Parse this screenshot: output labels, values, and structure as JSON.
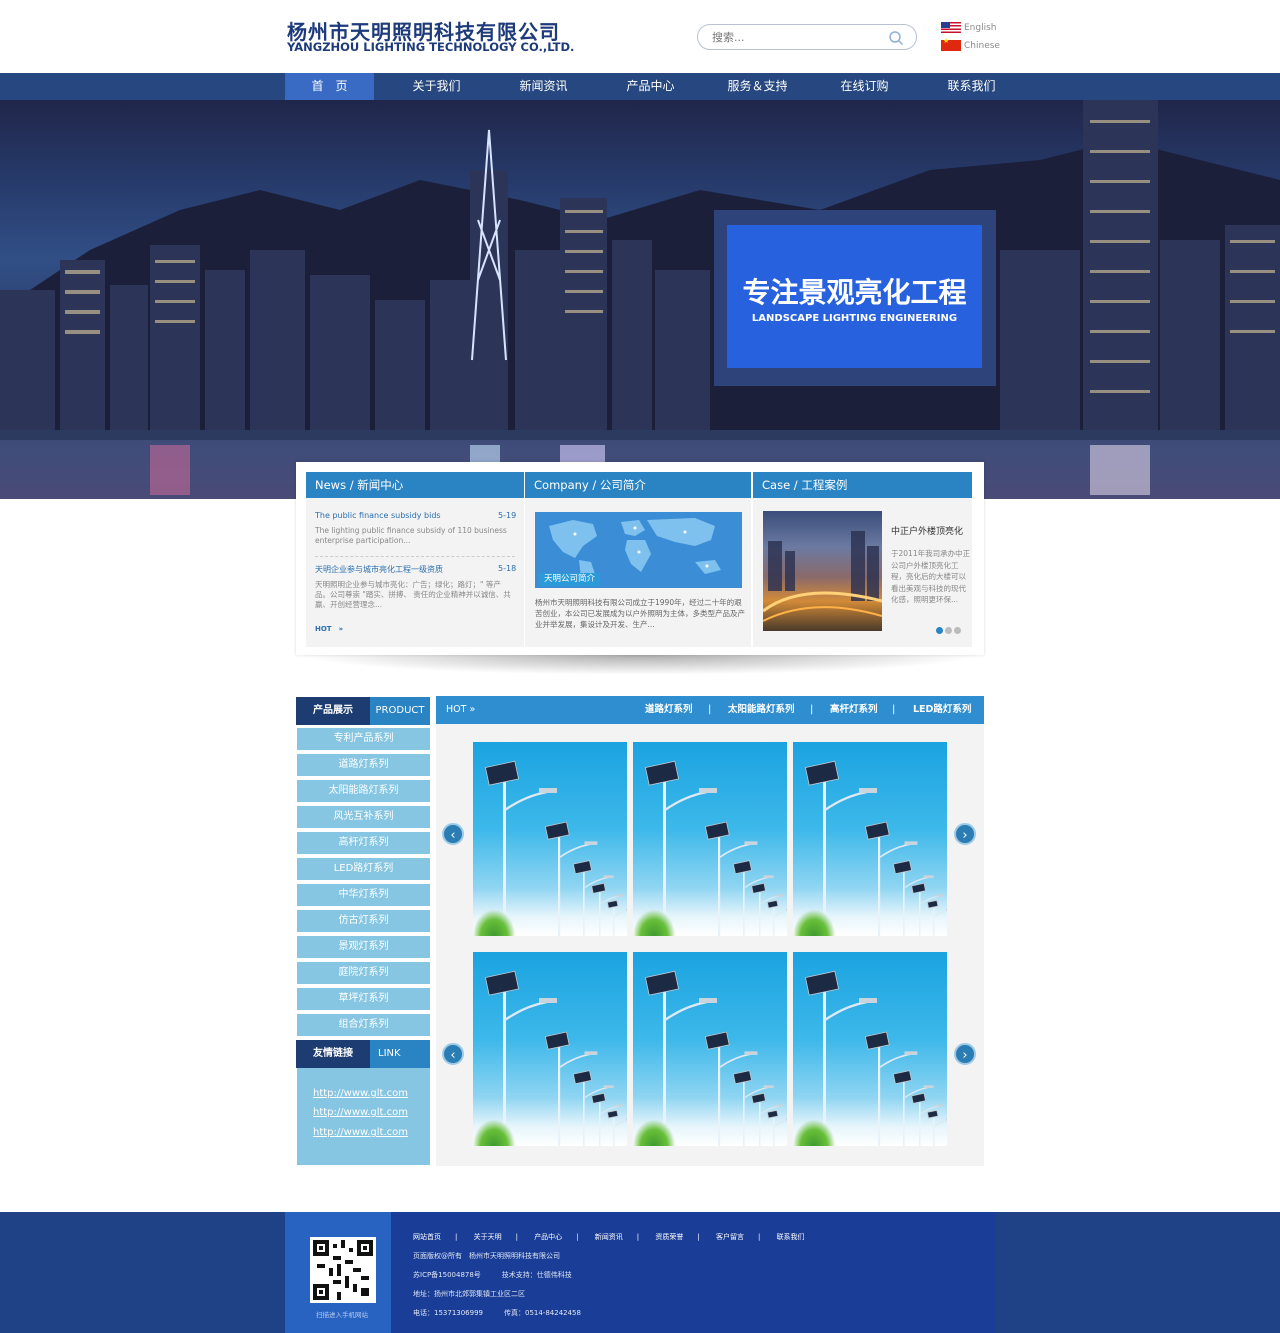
{
  "header": {
    "company_cn": "杨州市天明照明科技有限公司",
    "company_en": "YANGZHOU LIGHTING TECHNOLOGY CO.,LTD.",
    "search_placeholder": "搜索...",
    "lang_en": "English",
    "lang_cn": "Chinese"
  },
  "nav": {
    "items": [
      "首　页",
      "关于我们",
      "新闻资讯",
      "产品中心",
      "服务＆支持",
      "在线订购",
      "联系我们"
    ]
  },
  "banner": {
    "title": "专注景观亮化工程",
    "subtitle": "LANDSCAPE LIGHTING ENGINEERING"
  },
  "info": {
    "news": {
      "header": "News / 新闻中心",
      "items": [
        {
          "title": "The public finance subsidy bids",
          "date": "5-19",
          "desc": "The lighting public finance subsidy of 110 business enterprise participation..."
        },
        {
          "title": "天明企业参与城市亮化工程一级资质",
          "date": "5-18",
          "desc": "天明照明企业参与城市亮化：广告；绿化；路灯；\" 等产品。公司尊崇 \"踏实、拼搏、 责任的企业精神并以诚信、共赢、开创经营理念..."
        }
      ],
      "hot": "HOT"
    },
    "company": {
      "header": "Company / 公司简介",
      "image_label": "天明公司简介",
      "text": "杨州市天明照明科技有限公司成立于1990年，经过二十年的艰苦创业，本公司已发展成为以户外照明为主体，多类型产品及产业并举发展，集设计及开发、生产..."
    },
    "case": {
      "header": "Case / 工程案例",
      "title": "中正户外楼顶亮化",
      "desc": "于2011年我司承办中正公司户外楼顶亮化工程，亮化后的大楼可以看出美观与科技的现代化感，照明更环保..."
    }
  },
  "products": {
    "side_head_cn": "产品展示",
    "side_head_en": "PRODUCT",
    "categories": [
      "专利产品系列",
      "道路灯系列",
      "太阳能路灯系列",
      "风光互补系列",
      "高杆灯系列",
      "LED路灯系列",
      "中华灯系列",
      "仿古灯系列",
      "景观灯系列",
      "庭院灯系列",
      "草坪灯系列",
      "组合灯系列"
    ],
    "links_head_cn": "友情链接",
    "links_head_en": "LINK",
    "links": [
      "http://www.glt.com",
      "http://www.glt.com",
      "http://www.glt.com"
    ],
    "main_hot": "HOT",
    "main_cats": [
      "道路灯系列",
      "太阳能路灯系列",
      "高杆灯系列",
      "LED路灯系列"
    ]
  },
  "footer": {
    "qr_label": "扫描进入手机网站",
    "links": [
      "网站首页",
      "关于天明",
      "产品中心",
      "新闻资讯",
      "资质荣誉",
      "客户留言",
      "联系我们"
    ],
    "copyright": "页面版权@所有　杨州市天明照明科技有限公司",
    "icp": "苏ICP备15004878号　　　技术支持：仕德伟科技",
    "address": "地址：扬州市北郊郭集镇工业区二区",
    "phone": "电话：15371306999　　　传真：0514-84242458"
  },
  "colors": {
    "nav_bg": "#26477f",
    "nav_active": "#3a6bc4",
    "accent_blue": "#2a84c4",
    "side_item": "#86c6e2",
    "footer_bg": "#1f4287"
  }
}
